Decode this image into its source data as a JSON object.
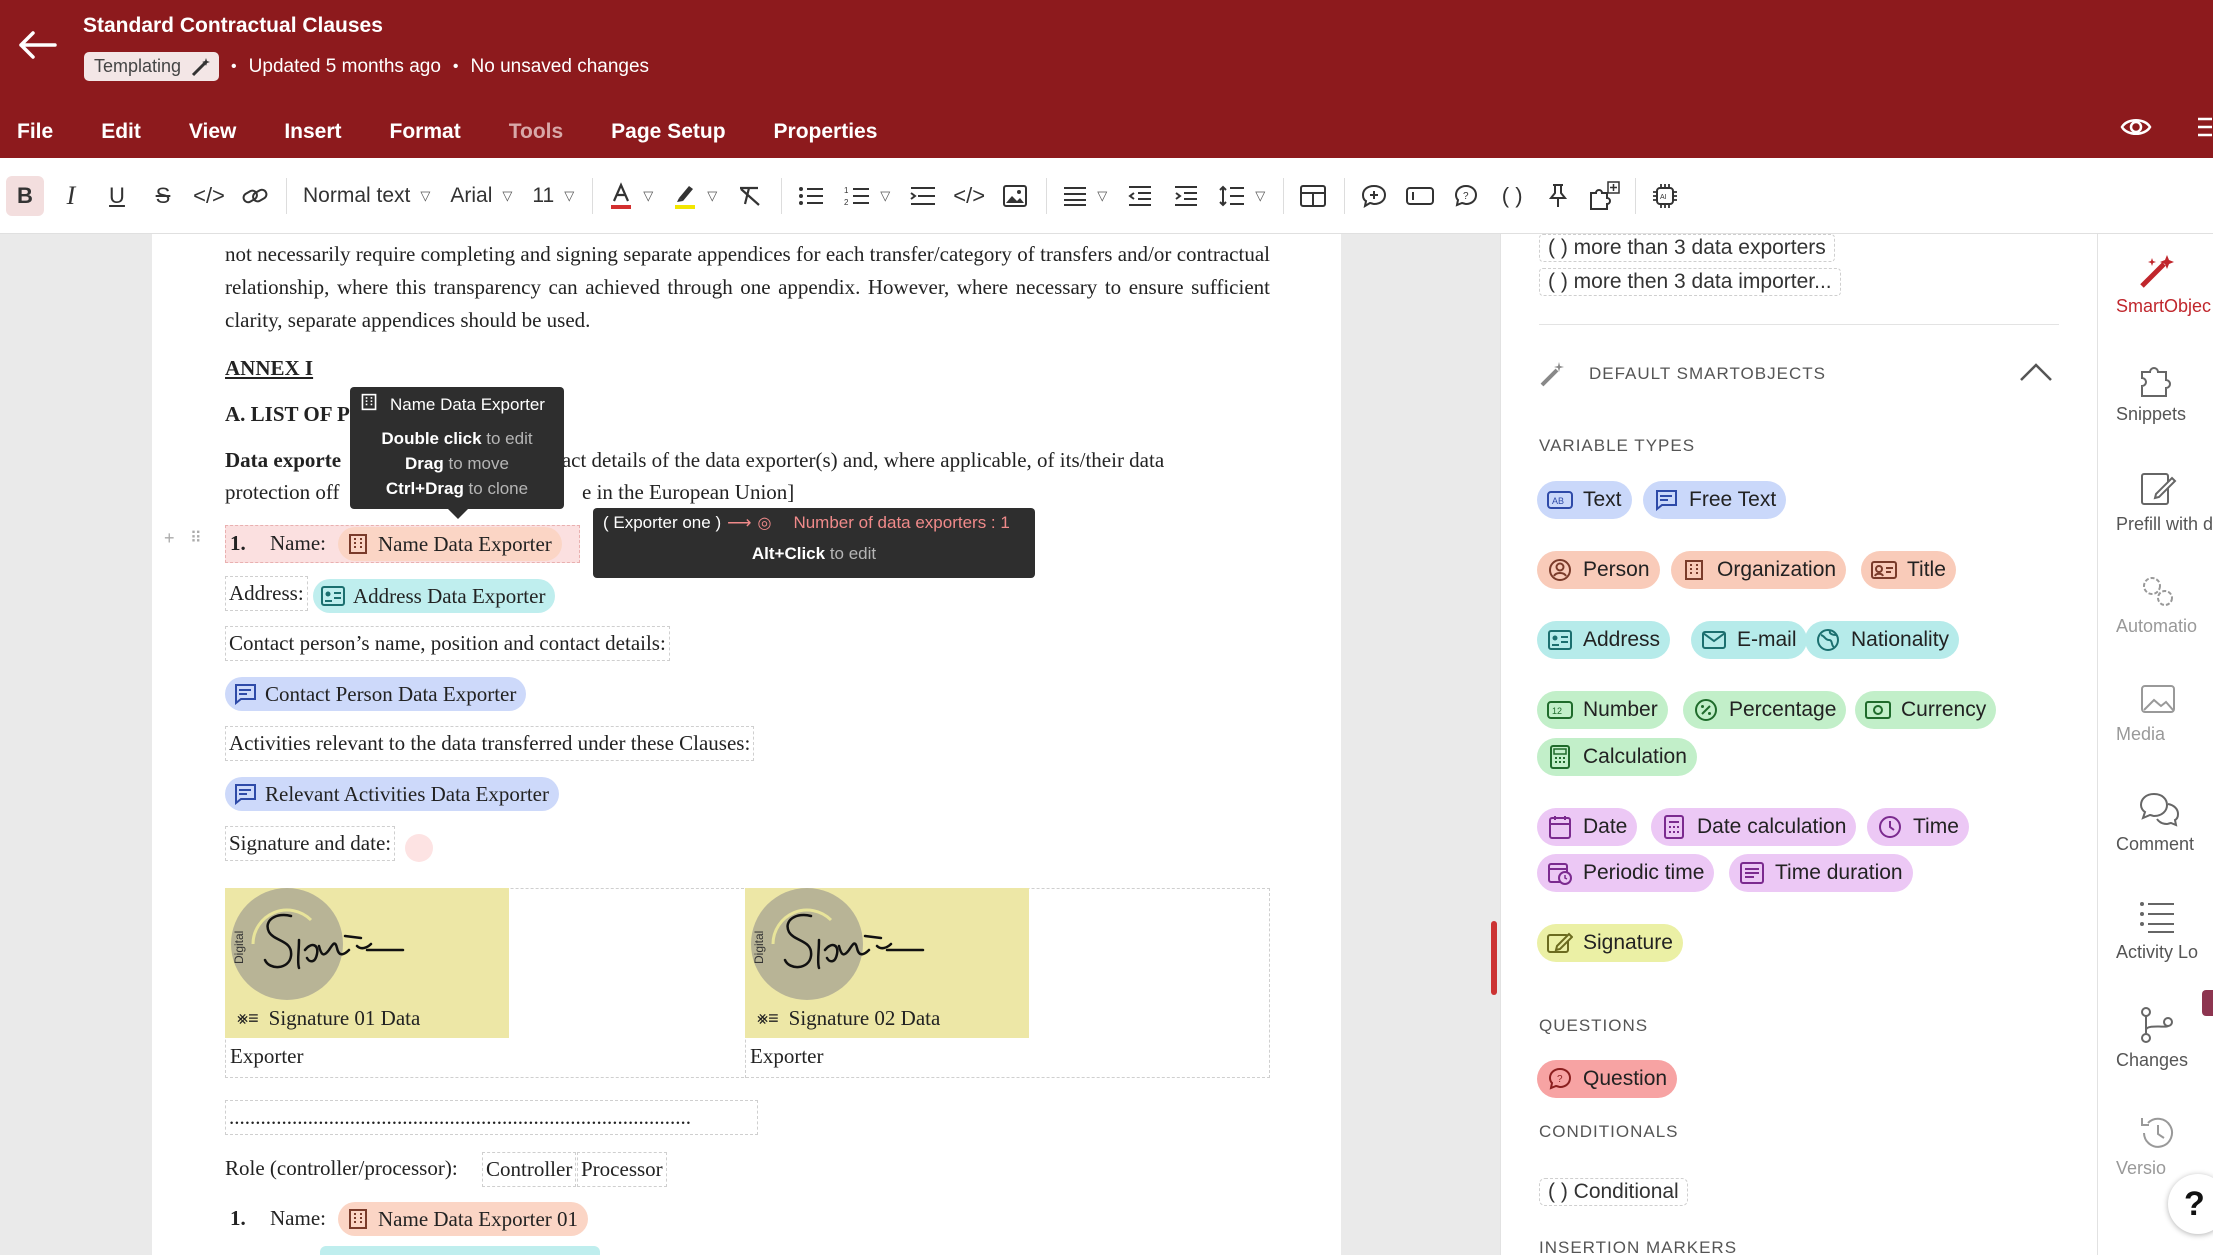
{
  "header": {
    "title": "Standard Contractual Clauses",
    "badge": "Templating",
    "updated": "Updated 5 months ago",
    "save_status": "No unsaved changes"
  },
  "menu": [
    "File",
    "Edit",
    "View",
    "Insert",
    "Format",
    "Tools",
    "Page Setup",
    "Properties"
  ],
  "toolbar": {
    "style": "Normal text",
    "font": "Arial",
    "size": "11"
  },
  "document": {
    "para1": "not necessarily require completing and signing separate appendices for each transfer/category of transfers and/or contractual relationship, where this transparency can achieved through one appendix. However, where necessary to ensure sufficient clarity, separate appendices should be used.",
    "annex": "ANNEX I",
    "list_of": "A. LIST OF P",
    "data_exporter_start": "Data exporte",
    "data_exporter_mid": "tact details of the data exporter(s) and, where applicable, of its/their data",
    "protection_start": "protection off",
    "protection_end": "e in the European Union]",
    "item1_num": "1.",
    "name_label": "Name:",
    "name_chip": "Name Data Exporter",
    "address_label": "Address:",
    "address_chip": "Address Data Exporter",
    "contact_label": "Contact person’s name, position and contact details:",
    "contact_chip": "Contact Person Data Exporter",
    "activities_label": "Activities relevant to the data transferred under these Clauses:",
    "activities_chip": "Relevant Activities Data Exporter",
    "signature_label": "Signature and date:",
    "sig1_caption": "Signature 01 Data",
    "sig2_caption": "Signature 02 Data",
    "sig_exporter": "Exporter",
    "dotted_line": "........................................................................................",
    "role_label": "Role (controller/processor):",
    "role_controller": "Controller",
    "role_processor": "Processor",
    "item1b_num": "1.",
    "name_chip2": "Name Data Exporter 01"
  },
  "tooltip1": {
    "title": "Name Data Exporter",
    "l1a": "Double click",
    "l1b": " to edit",
    "l2a": "Drag",
    "l2b": " to move",
    "l3a": "Ctrl+Drag",
    "l3b": " to clone"
  },
  "tooltip2": {
    "cond": "( Exporter one )",
    "arrow": "⟶",
    "counter": "Number of data exporters : 1",
    "l2a": "Alt+Click",
    "l2b": " to edit"
  },
  "panel": {
    "opt1": "( ) more than 3 data exporters",
    "opt2": "( ) more then 3 data importer...",
    "default_header": "DEFAULT SMARTOBJECTS",
    "variable_types": "VARIABLE TYPES",
    "pills": {
      "text": "Text",
      "free_text": "Free Text",
      "person": "Person",
      "organization": "Organization",
      "title": "Title",
      "address": "Address",
      "email": "E-mail",
      "nationality": "Nationality",
      "number": "Number",
      "percentage": "Percentage",
      "currency": "Currency",
      "calculation": "Calculation",
      "date": "Date",
      "date_calc": "Date calculation",
      "time": "Time",
      "periodic": "Periodic time",
      "duration": "Time duration",
      "signature": "Signature",
      "question": "Question",
      "conditional": "( ) Conditional"
    },
    "questions": "QUESTIONS",
    "conditionals": "CONDITIONALS",
    "insertion": "INSERTION MARKERS"
  },
  "rail": [
    "SmartObjec",
    "Snippets",
    "Prefill with d",
    "Automatio",
    "Media",
    "Comment",
    "Activity Lo",
    "Changes",
    "Versio"
  ],
  "rail_help": "?",
  "colors": {
    "brand": "#8d1a1d",
    "accent": "#c0262c"
  }
}
